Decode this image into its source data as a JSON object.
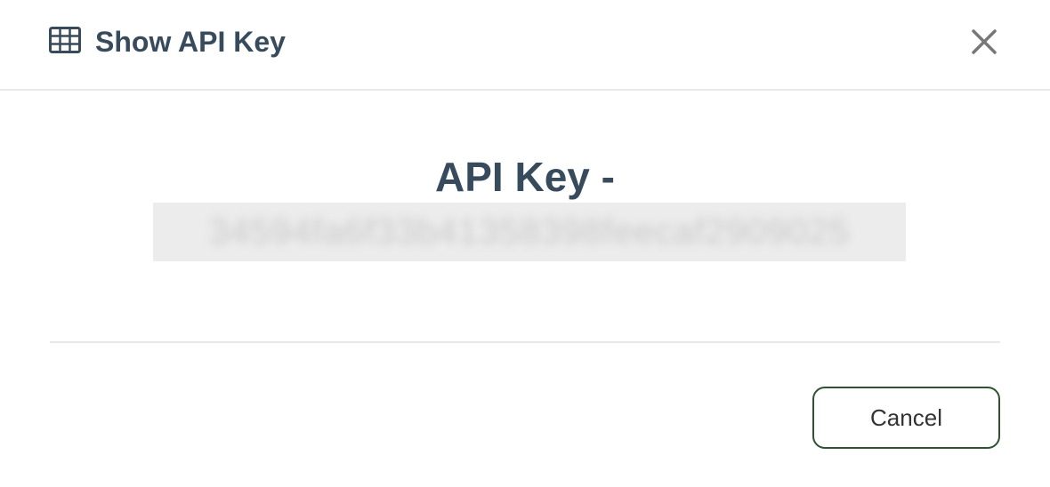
{
  "dialog": {
    "title": "Show API Key",
    "title_icon": "table-grid-icon",
    "close_icon": "close-icon"
  },
  "body": {
    "heading": "API Key -",
    "api_key_value": "34594fa6f33b41358398feecaf2909025",
    "api_key_redacted": true
  },
  "footer": {
    "cancel_label": "Cancel"
  },
  "colors": {
    "title_text": "#384b5c",
    "button_border": "#2f5233",
    "divider": "#e6e8ea",
    "key_background": "#ececec"
  }
}
